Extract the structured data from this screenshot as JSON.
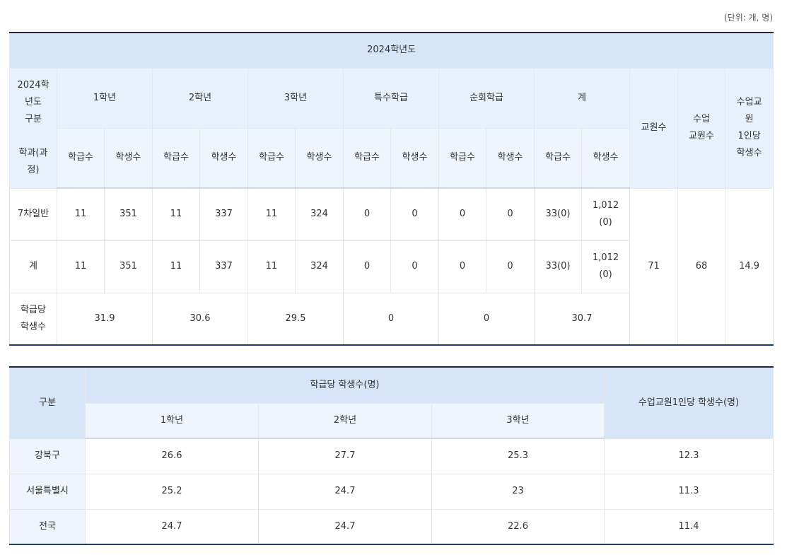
{
  "unit_note": "(단위: 개, 명)",
  "table1": {
    "year_header": "2024학년도",
    "corner": {
      "line1": "2024학",
      "line2": "년도",
      "line3": "구분",
      "line4": "학과(과",
      "line5": "정)"
    },
    "groups": [
      "1학년",
      "2학년",
      "3학년",
      "특수학급",
      "순회학급",
      "계"
    ],
    "sub_class": "학급수",
    "sub_student": "학생수",
    "col_teachers": "교원수",
    "col_class_teachers": {
      "line1": "수업",
      "line2": "교원수"
    },
    "col_ratio": {
      "line1": "수업교",
      "line2": "원",
      "line3": "1인당",
      "line4": "학생수"
    },
    "rows": [
      {
        "label": "7차일반",
        "cells": [
          "11",
          "351",
          "11",
          "337",
          "11",
          "324",
          "0",
          "0",
          "0",
          "0",
          "33(0)"
        ],
        "last_a": "1,012",
        "last_b": "(0)"
      },
      {
        "label": "계",
        "cells": [
          "11",
          "351",
          "11",
          "337",
          "11",
          "324",
          "0",
          "0",
          "0",
          "0",
          "33(0)"
        ],
        "last_a": "1,012",
        "last_b": "(0)"
      }
    ],
    "teachers": "71",
    "class_teachers": "68",
    "ratio": "14.9",
    "avg_label": {
      "line1": "학급당",
      "line2": "학생수"
    },
    "avg_values": [
      "31.9",
      "30.6",
      "29.5",
      "0",
      "0",
      "30.7"
    ]
  },
  "table2": {
    "corner": "구분",
    "group_header": "학급당 학생수(명)",
    "grades": [
      "1학년",
      "2학년",
      "3학년"
    ],
    "ratio_header": "수업교원1인당 학생수(명)",
    "rows": [
      {
        "label": "강북구",
        "values": [
          "26.6",
          "27.7",
          "25.3",
          "12.3"
        ]
      },
      {
        "label": "서울특별시",
        "values": [
          "25.2",
          "24.7",
          "23",
          "11.3"
        ]
      },
      {
        "label": "전국",
        "values": [
          "24.7",
          "24.7",
          "22.6",
          "11.4"
        ]
      }
    ]
  }
}
